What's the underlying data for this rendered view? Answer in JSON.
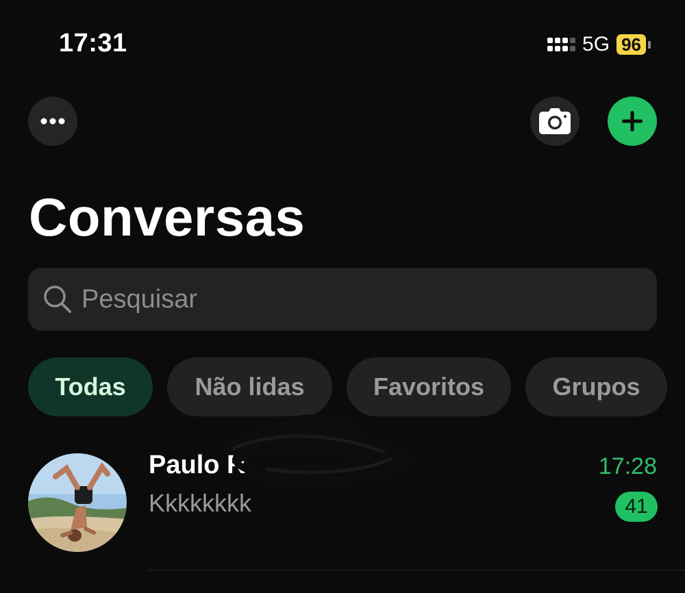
{
  "status_bar": {
    "time": "17:31",
    "network": "5G",
    "battery": "96"
  },
  "icons": {
    "more": "more-horizontal-icon",
    "camera": "camera-icon",
    "add": "plus-icon",
    "search": "search-icon"
  },
  "title": "Conversas",
  "search": {
    "placeholder": "Pesquisar"
  },
  "filters": [
    {
      "label": "Todas",
      "active": true
    },
    {
      "label": "Não lidas",
      "active": false
    },
    {
      "label": "Favoritos",
      "active": false
    },
    {
      "label": "Grupos",
      "active": false
    }
  ],
  "chats": [
    {
      "name": "Paulo R",
      "preview": "Kkkkkkkk",
      "time": "17:28",
      "unread": "41"
    }
  ],
  "colors": {
    "accent_green": "#21c063",
    "active_chip_bg": "#103629",
    "battery": "#f5d547"
  }
}
